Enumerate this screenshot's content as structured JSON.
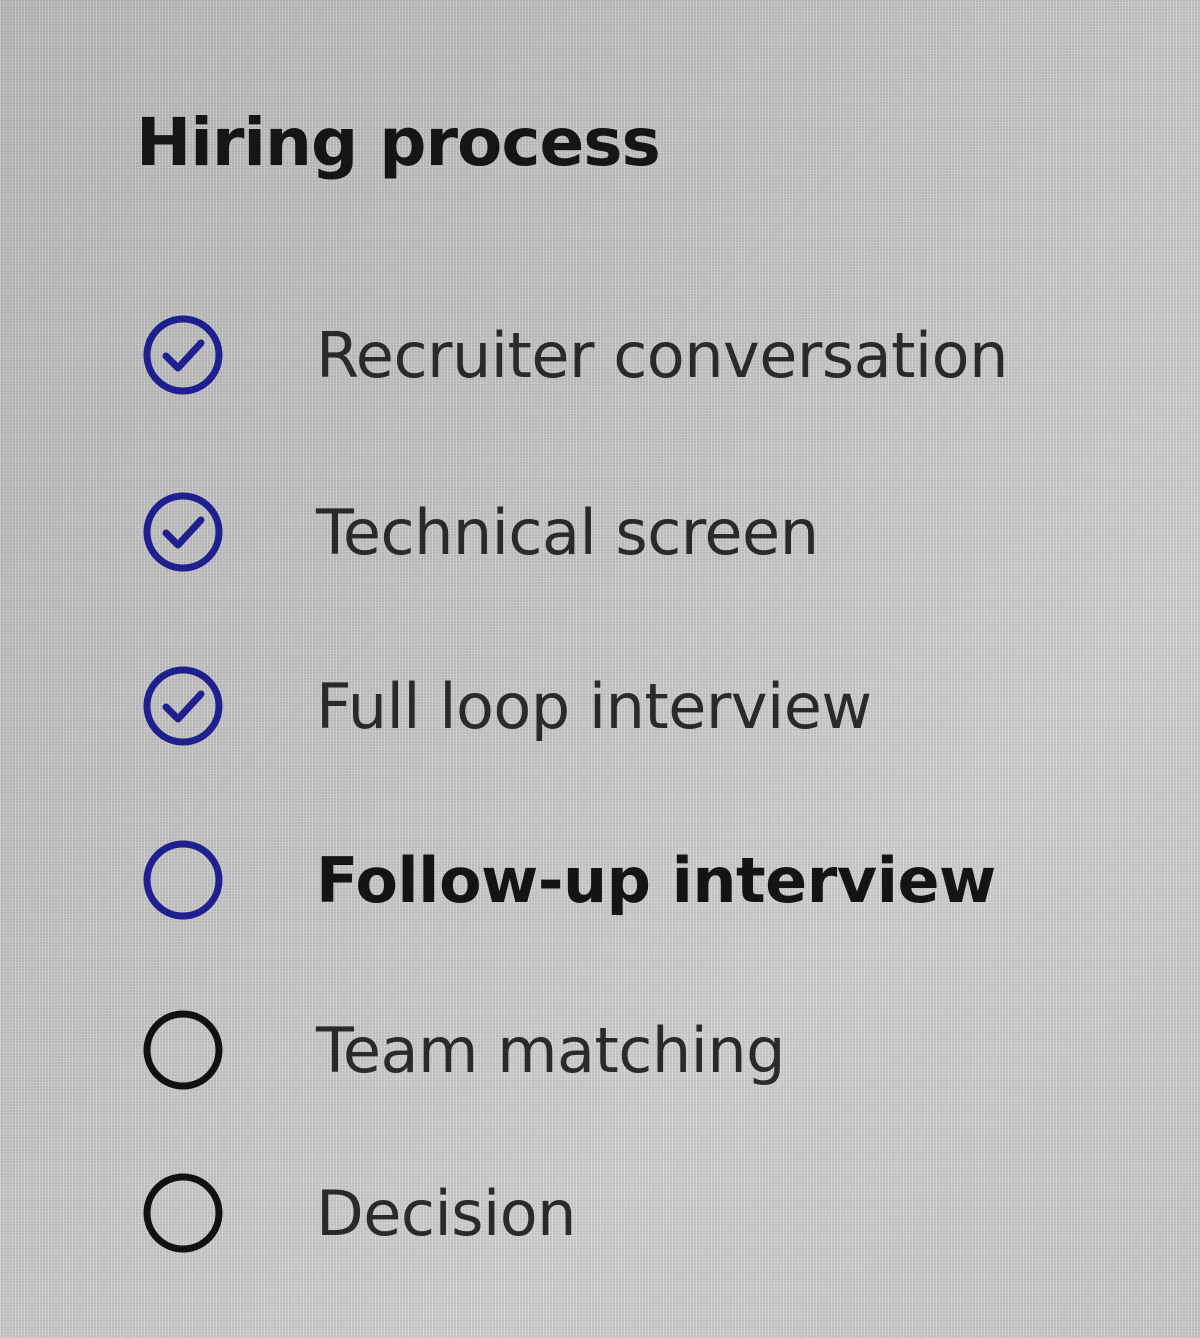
{
  "title": "Hiring process",
  "colors": {
    "completed": "#1f1f8f",
    "current": "#1f1f8f",
    "pending": "#111111"
  },
  "steps": [
    {
      "label": "Recruiter conversation",
      "status": "completed",
      "icon": "check-circle-icon"
    },
    {
      "label": "Technical screen",
      "status": "completed",
      "icon": "check-circle-icon"
    },
    {
      "label": "Full loop interview",
      "status": "completed",
      "icon": "check-circle-icon"
    },
    {
      "label": "Follow-up interview",
      "status": "current",
      "icon": "empty-circle-icon"
    },
    {
      "label": "Team matching",
      "status": "pending",
      "icon": "empty-circle-icon"
    },
    {
      "label": "Decision",
      "status": "pending",
      "icon": "empty-circle-icon"
    }
  ]
}
